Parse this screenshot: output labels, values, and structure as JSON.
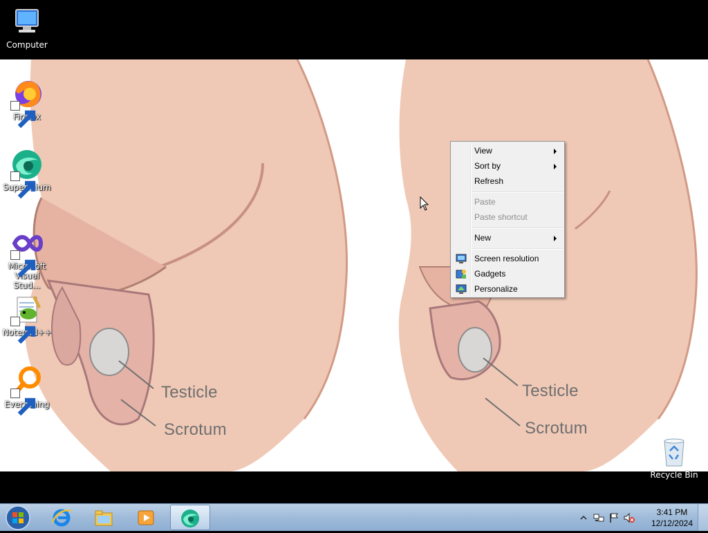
{
  "desktop": {
    "icons": [
      {
        "label": "Computer",
        "icon": "computer-icon",
        "shortcut": false
      },
      {
        "label": "Firefox",
        "icon": "firefox-icon",
        "shortcut": true
      },
      {
        "label": "Supermium",
        "icon": "supermium-icon",
        "shortcut": true
      },
      {
        "label": "Microsoft Visual Stud...",
        "icon": "visual-studio-icon",
        "shortcut": true
      },
      {
        "label": "Notepad++",
        "icon": "notepadpp-icon",
        "shortcut": true
      },
      {
        "label": "Everything",
        "icon": "everything-icon",
        "shortcut": true
      }
    ],
    "recycle_bin": {
      "label": "Recycle Bin",
      "icon": "recycle-bin-icon"
    }
  },
  "wallpaper": {
    "labels": [
      "Testicle",
      "Scrotum",
      "Testicle",
      "Scrotum"
    ],
    "colors": {
      "skin": "#efc9b6",
      "skin_shadow": "#d7a89a",
      "label": "#6e6e6e"
    }
  },
  "context_menu": {
    "items": [
      {
        "label": "View",
        "submenu": true,
        "disabled": false
      },
      {
        "label": "Sort by",
        "submenu": true,
        "disabled": false
      },
      {
        "label": "Refresh",
        "submenu": false,
        "disabled": false
      },
      {
        "label": "Paste",
        "submenu": false,
        "disabled": true
      },
      {
        "label": "Paste shortcut",
        "submenu": false,
        "disabled": true
      },
      {
        "label": "New",
        "submenu": true,
        "disabled": false
      },
      {
        "label": "Screen resolution",
        "submenu": false,
        "disabled": false,
        "icon": "screen-resolution-icon"
      },
      {
        "label": "Gadgets",
        "submenu": false,
        "disabled": false,
        "icon": "gadgets-icon"
      },
      {
        "label": "Personalize",
        "submenu": false,
        "disabled": false,
        "icon": "personalize-icon"
      }
    ]
  },
  "taskbar": {
    "pinned": [
      {
        "icon": "internet-explorer-icon"
      },
      {
        "icon": "file-explorer-icon"
      },
      {
        "icon": "media-player-icon"
      },
      {
        "icon": "supermium-icon",
        "active": true
      }
    ],
    "clock": {
      "time": "3:41 PM",
      "date": "12/12/2024"
    },
    "tray_icons": [
      "show-hidden-icons-icon",
      "network-icon",
      "action-center-flag-icon",
      "volume-muted-icon"
    ]
  }
}
